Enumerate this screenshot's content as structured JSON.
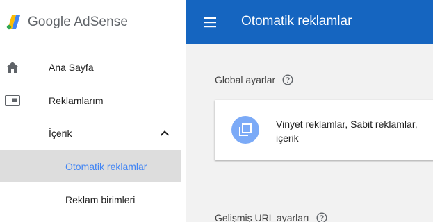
{
  "brand": {
    "name": "Google AdSense",
    "colors": {
      "yellow": "#fbbc05",
      "green": "#34a853",
      "blue": "#4285f4"
    }
  },
  "header": {
    "title": "Otomatik reklamlar",
    "background": "#1565c0",
    "menu_icon": "menu-icon"
  },
  "sidebar": {
    "items": [
      {
        "label": "Ana Sayfa",
        "icon": "home-icon"
      },
      {
        "label": "Reklamlarım",
        "icon": "ad-units-icon"
      },
      {
        "label": "İçerik",
        "icon": "chevron-up-icon",
        "expanded": true
      },
      {
        "label": "Otomatik reklamlar",
        "active": true
      },
      {
        "label": "Reklam birimleri"
      }
    ]
  },
  "main": {
    "global_section": {
      "title": "Global ayarlar",
      "icon": "help-icon"
    },
    "card": {
      "icon": "library-icon",
      "text": "Vinyet reklamlar, Sabit reklamlar, içerik"
    },
    "url_section": {
      "title": "Gelişmiş URL ayarları",
      "icon": "help-icon"
    }
  },
  "colors": {
    "active_item_bg": "#dddddd",
    "active_item_text": "#4285f4",
    "card_icon_bg": "#7baaf7"
  }
}
